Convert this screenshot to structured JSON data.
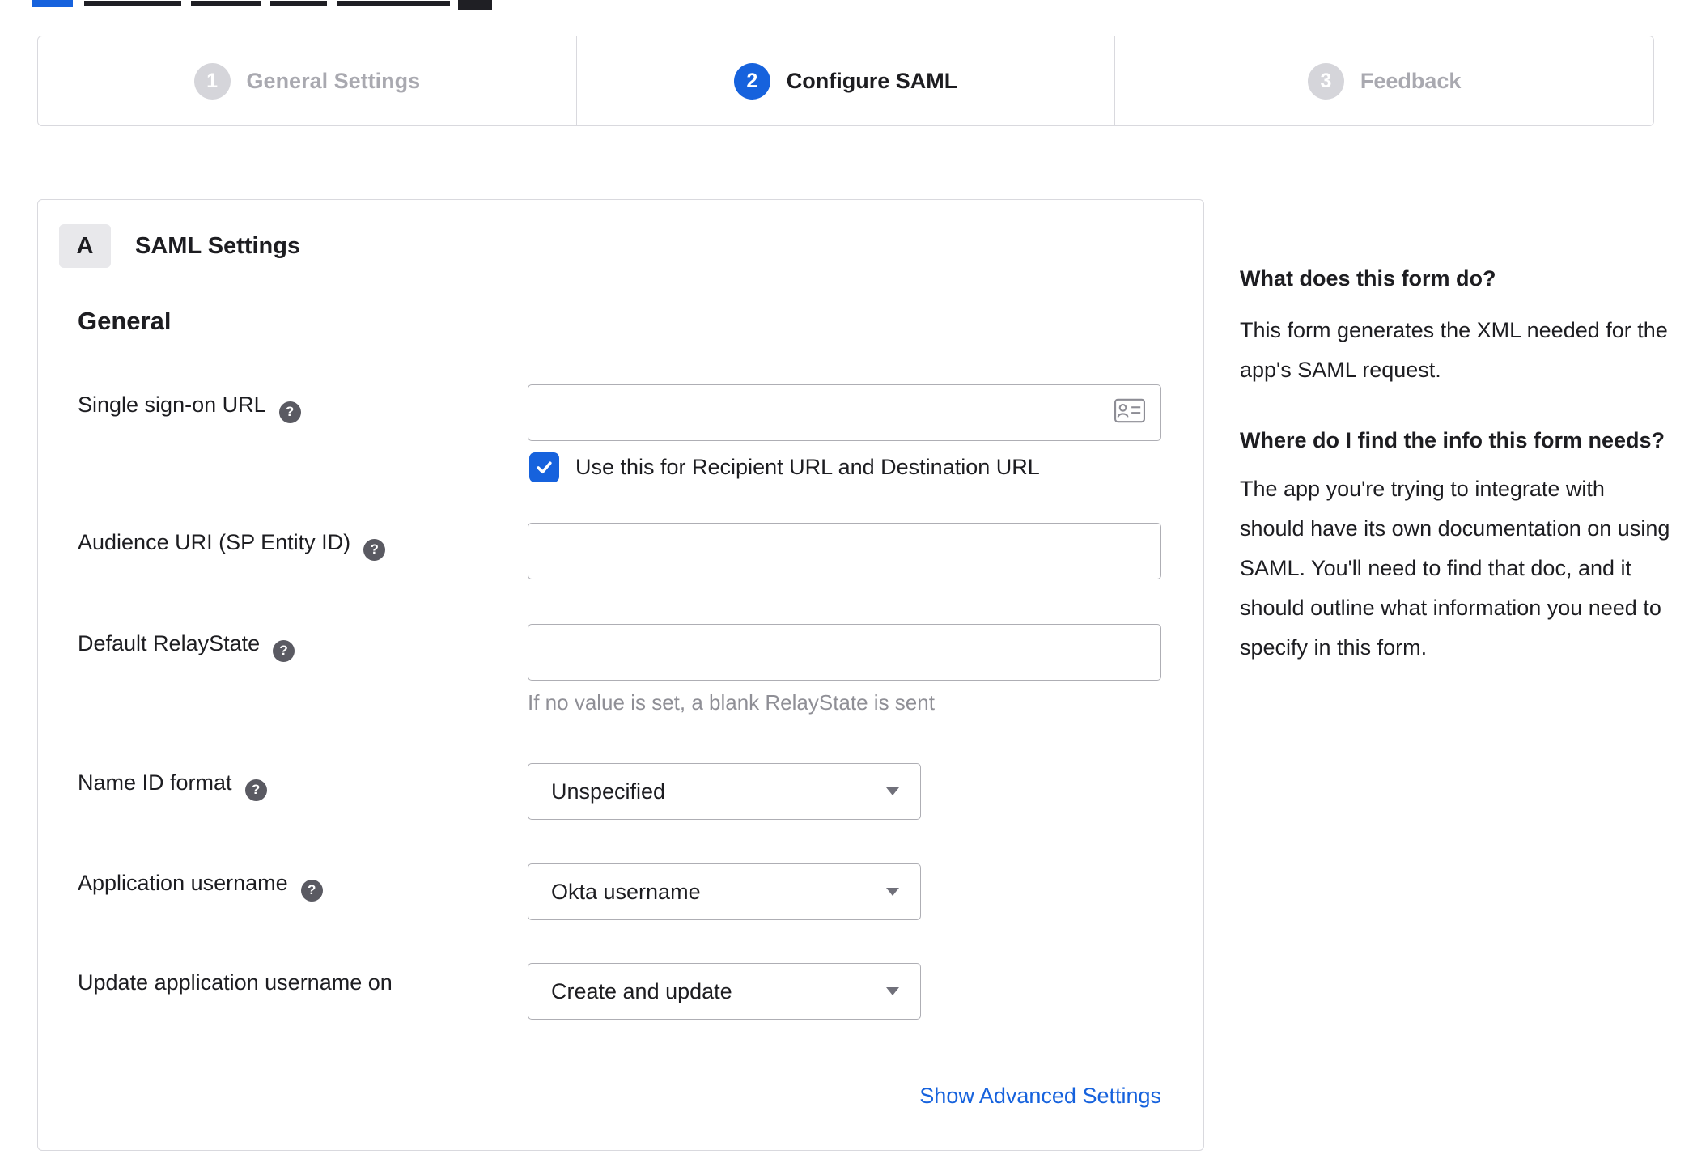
{
  "accent_color": "#1662dd",
  "icons": {
    "help": "?",
    "checkbox_check": "check-mark",
    "dropdown_caret": "chevron-down",
    "sso_input_icon": "address-card"
  },
  "stepper": {
    "steps": [
      {
        "number": "1",
        "label": "General Settings",
        "state": "inactive"
      },
      {
        "number": "2",
        "label": "Configure SAML",
        "state": "active"
      },
      {
        "number": "3",
        "label": "Feedback",
        "state": "inactive"
      }
    ]
  },
  "panel": {
    "section_badge": "A",
    "section_title": "SAML Settings",
    "group_title": "General",
    "fields": {
      "sso": {
        "label": "Single sign-on URL",
        "value": "",
        "checkbox_label": "Use this for Recipient URL and Destination URL",
        "checkbox_checked": true
      },
      "audience": {
        "label": "Audience URI (SP Entity ID)",
        "value": ""
      },
      "relay": {
        "label": "Default RelayState",
        "value": "",
        "hint": "If no value is set, a blank RelayState is sent"
      },
      "nameid": {
        "label": "Name ID format",
        "value": "Unspecified"
      },
      "appuser": {
        "label": "Application username",
        "value": "Okta username"
      },
      "updateuser": {
        "label": "Update application username on",
        "value": "Create and update"
      }
    },
    "advanced_link": "Show Advanced Settings"
  },
  "sidebar": {
    "q1": "What does this form do?",
    "a1": "This form generates the XML needed for the app's SAML request.",
    "q2": "Where do I find the info this form needs?",
    "a2": "The app you're trying to integrate with should have its own documentation on using SAML. You'll need to find that doc, and it should outline what information you need to specify in this form."
  }
}
